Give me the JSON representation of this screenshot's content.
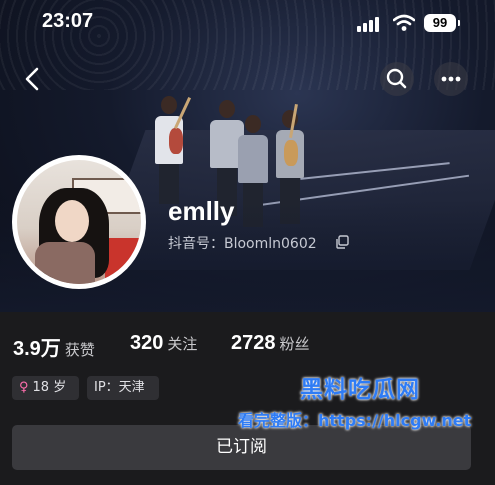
{
  "status_bar": {
    "time": "23:07",
    "battery": "99"
  },
  "profile": {
    "name": "emlly",
    "douyin_id": "抖音号：Bloomln0602"
  },
  "stats": [
    {
      "value": "3.9万",
      "label": "获赞"
    },
    {
      "value": "320",
      "label": "关注"
    },
    {
      "value": "2728",
      "label": "粉丝"
    }
  ],
  "tags": {
    "age": "18 岁",
    "ip": "IP：天津"
  },
  "actions": {
    "followed_label": "已订阅"
  },
  "watermark": {
    "brand": "黑料吃瓜网",
    "url_text": "看完整版：https://hlcgw.net"
  },
  "icons": {
    "back": "chevron-left-icon",
    "search": "search-icon",
    "more": "more-icon",
    "copy": "copy-icon",
    "gender": "female-icon",
    "signal": "cellular-signal-icon",
    "wifi": "wifi-icon"
  },
  "colors": {
    "accent_gender": "#ff6fae",
    "background": "#1b1b1d",
    "watermark": "#2f7cf5"
  }
}
